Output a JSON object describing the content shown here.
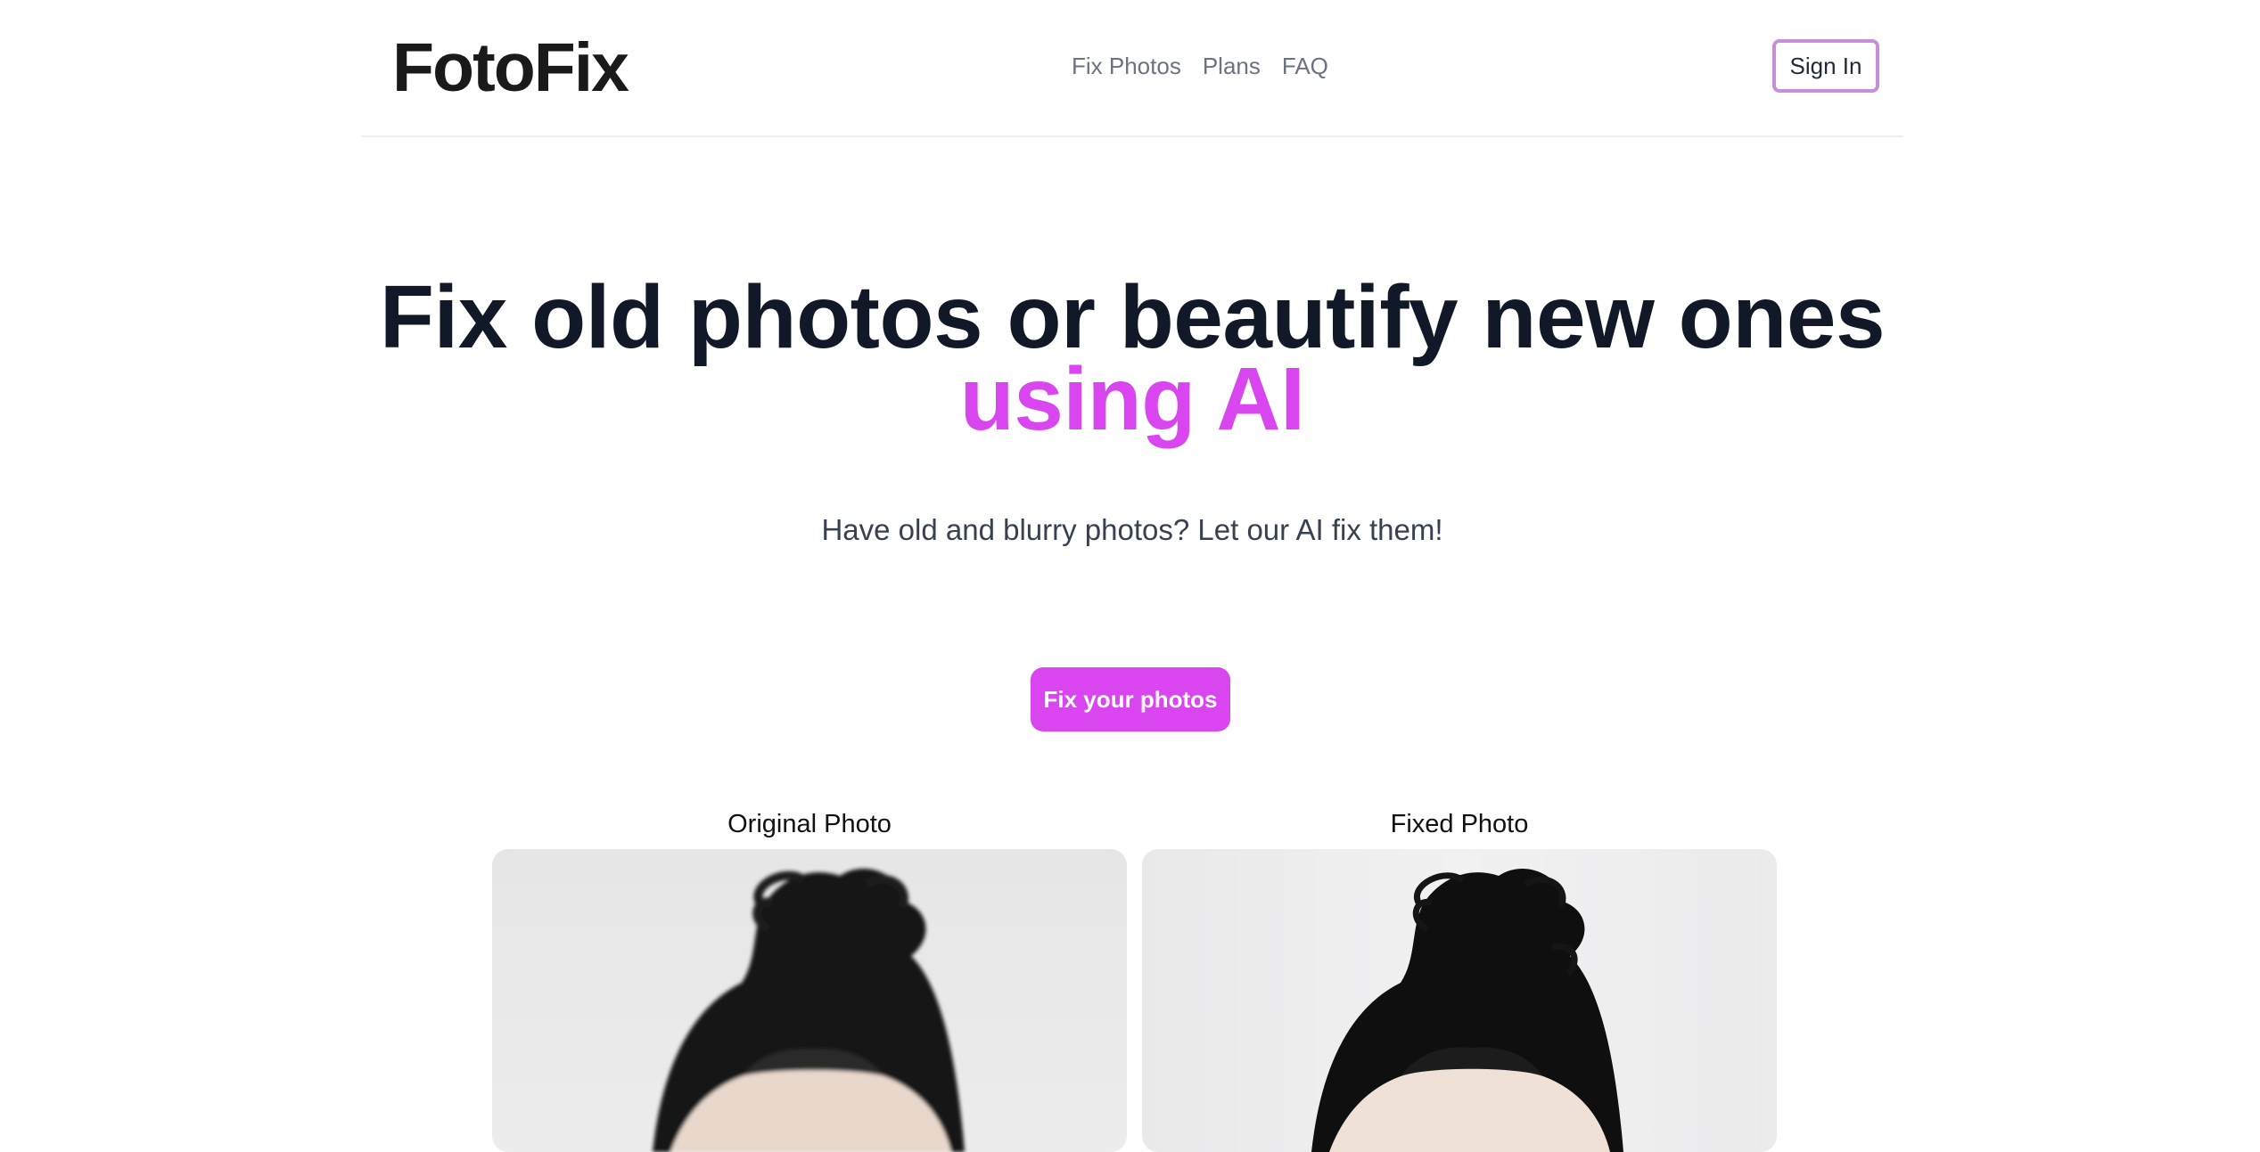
{
  "header": {
    "logo": "FotoFix",
    "nav": [
      "Fix Photos",
      "Plans",
      "FAQ"
    ],
    "signin_label": "Sign In"
  },
  "hero": {
    "title_main": "Fix old photos or beautify new ones",
    "title_accent": "using AI",
    "subtitle": "Have old and blurry photos? Let our AI fix them!",
    "cta_label": "Fix your photos"
  },
  "comparison": {
    "original_label": "Original Photo",
    "fixed_label": "Fixed Photo"
  },
  "colors": {
    "accent": "#d946ef",
    "signin_border": "#c78fd6",
    "text_dark": "#111827"
  }
}
